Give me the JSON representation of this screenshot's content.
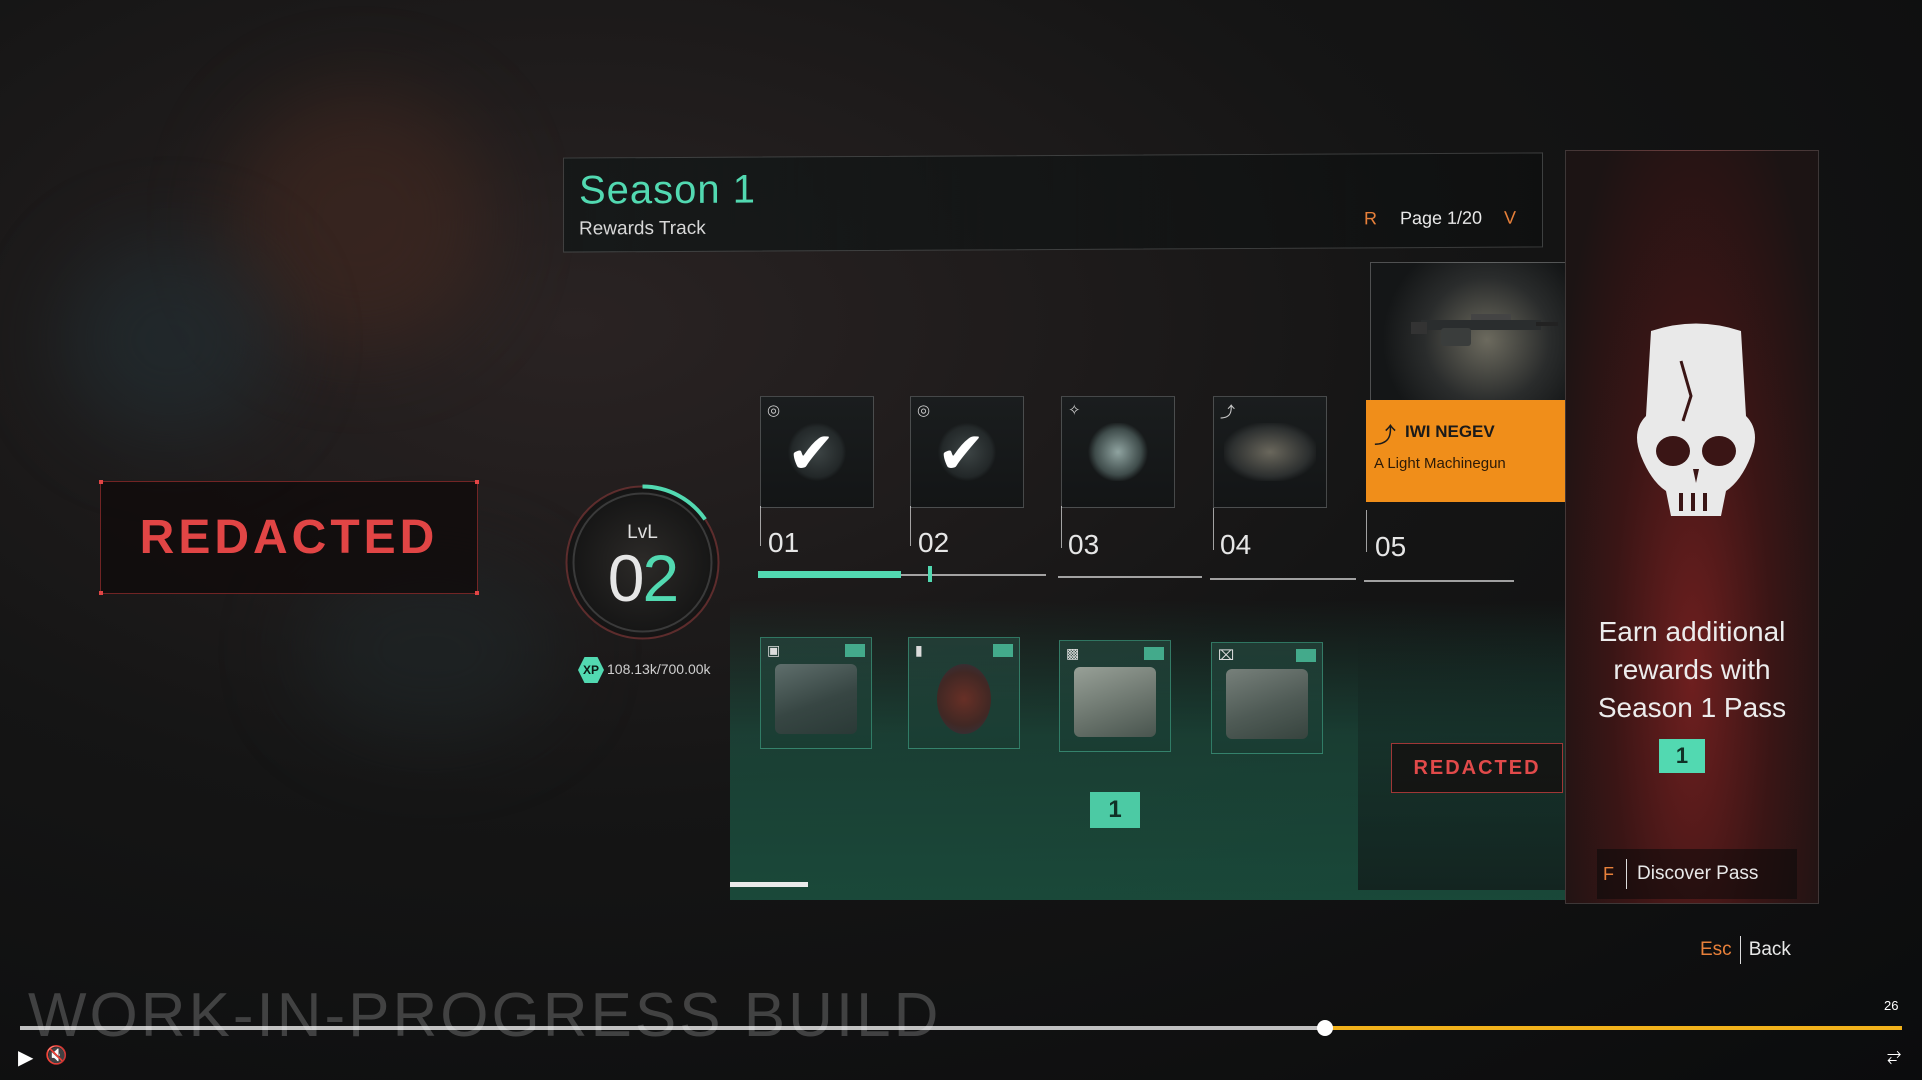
{
  "header": {
    "title": "Season 1",
    "subtitle": "Rewards Track",
    "prev_key": "R",
    "page_label": "Page 1/20",
    "next_key": "V"
  },
  "left_redacted": "REDACTED",
  "level": {
    "label": "LvL",
    "value": "02",
    "xp_badge": "XP",
    "xp_text": "108.13k/700.00k",
    "xp_progress": 0.154
  },
  "tiers": [
    {
      "label": "01",
      "claimed": true
    },
    {
      "label": "02",
      "claimed": true
    },
    {
      "label": "03",
      "claimed": false
    },
    {
      "label": "04",
      "claimed": false
    },
    {
      "label": "05",
      "claimed": false
    }
  ],
  "track_progress": 0.28,
  "pass_ticket_label": "1",
  "featured": {
    "name": "IWI NEGEV",
    "description": "A Light Machinegun",
    "icon": "machinegun-icon"
  },
  "right_redacted": "REDACTED",
  "pass_panel": {
    "text_line1": "Earn additional",
    "text_line2": "rewards with",
    "text_line3": "Season 1 Pass",
    "icon_label": "1"
  },
  "discover": {
    "key": "F",
    "label": "Discover Pass"
  },
  "back": {
    "key": "Esc",
    "label": "Back"
  },
  "watermark": "WORK-IN-PROGRESS BUILD",
  "video": {
    "time": "26",
    "progress": 0.69
  },
  "colors": {
    "accent": "#52d9b1",
    "orange": "#f08e1a",
    "red": "#e14545",
    "key": "#e8803a"
  }
}
